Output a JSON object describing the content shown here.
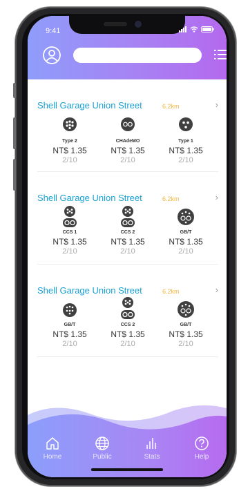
{
  "status_bar": {
    "time": "9:41"
  },
  "search": {
    "value": "",
    "placeholder": ""
  },
  "stations": [
    {
      "name": "Shell Garage Union Street",
      "distance": "6.2km",
      "connectors": [
        {
          "type": "Type 2",
          "icon": "type2-connector-icon",
          "price": "NT$ 1.35",
          "availability": "2/10"
        },
        {
          "type": "CHAdeMO",
          "icon": "chademo-connector-icon",
          "price": "NT$ 1.35",
          "availability": "2/10"
        },
        {
          "type": "Type 1",
          "icon": "type1-connector-icon",
          "price": "NT$ 1.35",
          "availability": "2/10"
        }
      ]
    },
    {
      "name": "Shell Garage Union Street",
      "distance": "6.2km",
      "connectors": [
        {
          "type": "CCS 1",
          "icon": "ccs-connector-icon",
          "price": "NT$ 1.35",
          "availability": "2/10"
        },
        {
          "type": "CCS 2",
          "icon": "ccs-connector-icon",
          "price": "NT$ 1.35",
          "availability": "2/10"
        },
        {
          "type": "GB/T",
          "icon": "gbt-connector-icon",
          "price": "NT$ 1.35",
          "availability": "2/10"
        }
      ]
    },
    {
      "name": "Shell Garage Union Street",
      "distance": "6.2km",
      "connectors": [
        {
          "type": "GB/T",
          "icon": "gbt-connector-icon",
          "price": "NT$ 1.35",
          "availability": "2/10"
        },
        {
          "type": "CCS 2",
          "icon": "ccs-connector-icon",
          "price": "NT$ 1.35",
          "availability": "2/10"
        },
        {
          "type": "GB/T",
          "icon": "gbt-connector-icon",
          "price": "NT$ 1.35",
          "availability": "2/10"
        }
      ]
    }
  ],
  "nav": [
    {
      "label": "Home",
      "icon": "home-icon"
    },
    {
      "label": "Public",
      "icon": "globe-icon"
    },
    {
      "label": "Stats",
      "icon": "stats-icon"
    },
    {
      "label": "Help",
      "icon": "help-icon"
    }
  ],
  "colors": {
    "header_gradient_start": "#8f9dfb",
    "header_gradient_end": "#b469ee",
    "station_name": "#1aa2d4",
    "distance": "#f4b63b"
  }
}
